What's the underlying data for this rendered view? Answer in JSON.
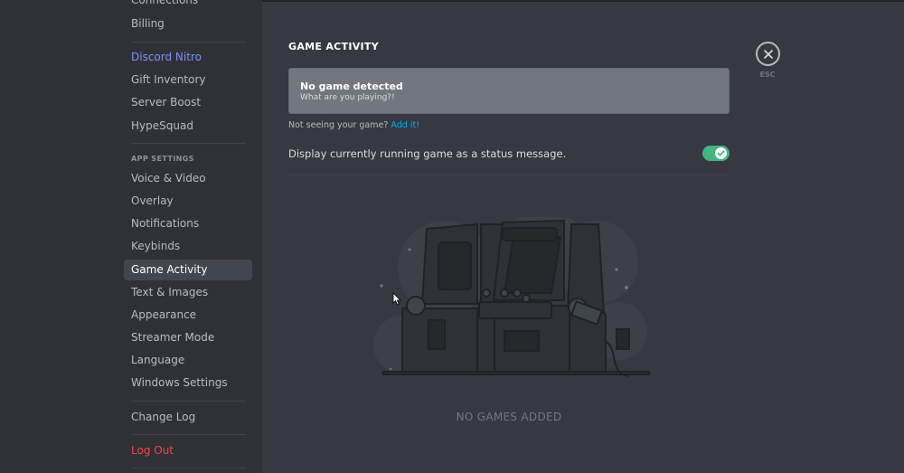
{
  "sidebar": {
    "items_top": [
      {
        "label": "Connections"
      },
      {
        "label": "Billing"
      }
    ],
    "nitro_group": [
      {
        "label": "Discord Nitro"
      },
      {
        "label": "Gift Inventory"
      },
      {
        "label": "Server Boost"
      },
      {
        "label": "HypeSquad"
      }
    ],
    "app_settings_header": "APP SETTINGS",
    "app_settings": [
      {
        "label": "Voice & Video"
      },
      {
        "label": "Overlay"
      },
      {
        "label": "Notifications"
      },
      {
        "label": "Keybinds"
      },
      {
        "label": "Game Activity"
      },
      {
        "label": "Text & Images"
      },
      {
        "label": "Appearance"
      },
      {
        "label": "Streamer Mode"
      },
      {
        "label": "Language"
      },
      {
        "label": "Windows Settings"
      }
    ],
    "change_log": "Change Log",
    "log_out": "Log Out"
  },
  "main": {
    "title": "GAME ACTIVITY",
    "game_box": {
      "title": "No game detected",
      "subtitle": "What are you playing?!"
    },
    "not_seeing": {
      "text": "Not seeing your game?",
      "link": "Add it!"
    },
    "status_toggle": {
      "label": "Display currently running game as a status message.",
      "enabled": true
    },
    "empty_state": "NO GAMES ADDED"
  },
  "close": {
    "esc_label": "ESC"
  },
  "colors": {
    "accent": "#7289da",
    "toggle_on": "#43b581",
    "danger": "#f04747",
    "link": "#00b0f4"
  }
}
